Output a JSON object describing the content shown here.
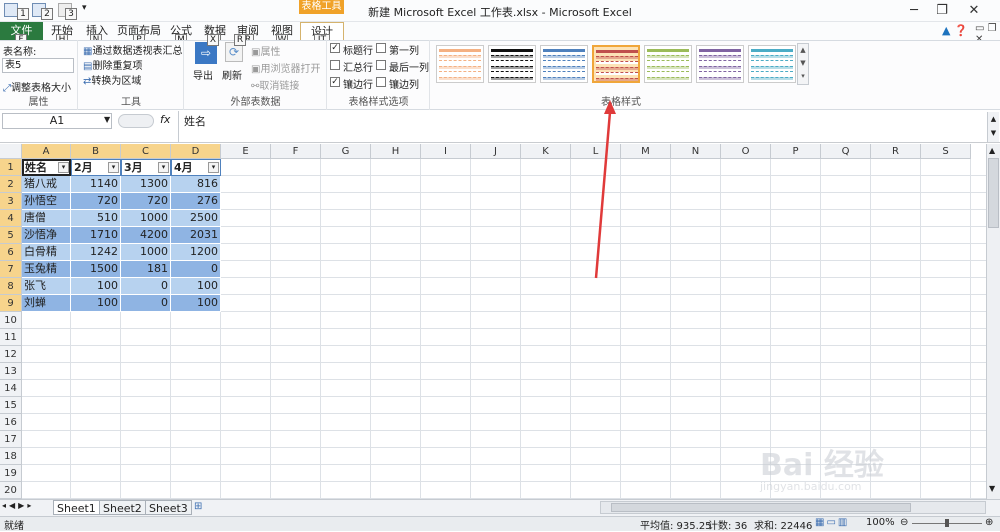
{
  "window": {
    "title": "新建 Microsoft Excel 工作表.xlsx - Microsoft Excel",
    "context_tab_group": "表格工具",
    "quick_access_keys": [
      "1",
      "2",
      "3"
    ]
  },
  "tabs": [
    {
      "label": "文件",
      "key": "F"
    },
    {
      "label": "开始",
      "key": "H"
    },
    {
      "label": "插入",
      "key": "N"
    },
    {
      "label": "页面布局",
      "key": "P"
    },
    {
      "label": "公式",
      "key": "M"
    },
    {
      "label": "数据",
      "key": "A"
    },
    {
      "label": "审阅",
      "key": "R"
    },
    {
      "label": "视图",
      "key": "W"
    },
    {
      "label": "设计",
      "key": "JT"
    }
  ],
  "ribbon": {
    "properties": {
      "table_name_label": "表名称:",
      "table_name_value": "表5",
      "resize_label": "调整表格大小",
      "group": "属性"
    },
    "tools": {
      "pivot": "通过数据透视表汇总",
      "remove_dup": "删除重复项",
      "convert": "转换为区域",
      "group": "工具"
    },
    "external": {
      "export": "导出",
      "refresh": "刷新",
      "properties": "属性",
      "open_browser": "用浏览器打开",
      "unlink": "取消链接",
      "group": "外部表数据"
    },
    "style_options": {
      "header_row": "标题行",
      "first_col": "第一列",
      "total_row": "汇总行",
      "last_col": "最后一列",
      "banded_rows": "镶边行",
      "banded_cols": "镶边列",
      "header_row_checked": true,
      "banded_rows_checked": true,
      "group": "表格样式选项"
    },
    "table_styles": {
      "group": "表格样式",
      "swatches": [
        "#f4b183",
        "#111111",
        "#4f81bd",
        "#c0504d",
        "#9bbb59",
        "#8064a2",
        "#4bacc6"
      ],
      "selected_index": 3
    }
  },
  "formula_bar": {
    "name_box": "A1",
    "fx": "fx",
    "content": "姓名"
  },
  "columns": [
    "A",
    "B",
    "C",
    "D",
    "E",
    "F",
    "G",
    "H",
    "I",
    "J",
    "K",
    "L",
    "M",
    "N",
    "O",
    "P",
    "Q",
    "R",
    "S"
  ],
  "rows": [
    "1",
    "2",
    "3",
    "4",
    "5",
    "6",
    "7",
    "8",
    "9",
    "10",
    "11",
    "12",
    "13",
    "14",
    "15",
    "16",
    "17",
    "18",
    "19",
    "20"
  ],
  "table": {
    "headers": [
      "姓名",
      "2月",
      "3月",
      "4月"
    ],
    "rows": [
      [
        "猪八戒",
        "1140",
        "1300",
        "816"
      ],
      [
        "孙悟空",
        "720",
        "720",
        "276"
      ],
      [
        "唐僧",
        "510",
        "1000",
        "2500"
      ],
      [
        "沙悟净",
        "1710",
        "4200",
        "2031"
      ],
      [
        "白骨精",
        "1242",
        "1000",
        "1200"
      ],
      [
        "玉兔精",
        "1500",
        "181",
        "0"
      ],
      [
        "张飞",
        "100",
        "0",
        "100"
      ],
      [
        "刘蝉",
        "100",
        "0",
        "100"
      ]
    ],
    "band_colors": [
      "#b7d2ef",
      "#8fb4e3"
    ],
    "header_color": "#ffffff"
  },
  "sheets": [
    "Sheet1",
    "Sheet2",
    "Sheet3"
  ],
  "status": {
    "mode": "就绪",
    "average": "平均值: 935.25",
    "count": "计数: 36",
    "sum": "求和: 22446",
    "zoom": "100%"
  },
  "watermark": {
    "brand": "Bai 经验",
    "url": "jingyan.baidu.com"
  },
  "accent": {
    "arrow": "#e03a3a",
    "file_tab": "#2b7a3f",
    "context": "#f0a229"
  }
}
